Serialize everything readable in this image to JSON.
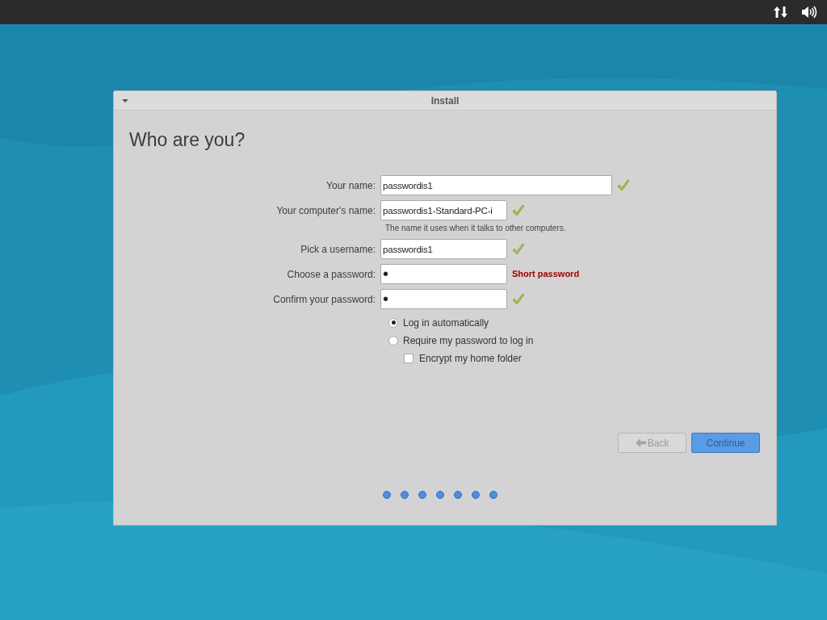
{
  "window": {
    "title": "Install"
  },
  "heading": "Who are you?",
  "fields": [
    {
      "label": "Your name:",
      "value": "passwordis1",
      "wide": true,
      "valid": true
    },
    {
      "label": "Your computer's name:",
      "value": "passwordis1-Standard-PC-i",
      "wide": false,
      "valid": true,
      "hint": "The name it uses when it talks to other computers."
    },
    {
      "label": "Pick a username:",
      "value": "passwordis1",
      "wide": false,
      "valid": true
    },
    {
      "label": "Choose a password:",
      "value": "•",
      "kind": "password",
      "wide": false,
      "valid": false,
      "message": "Short password"
    },
    {
      "label": "Confirm your password:",
      "value": "•",
      "kind": "password",
      "wide": false,
      "valid": true
    }
  ],
  "login_options": [
    {
      "label": "Log in automatically",
      "selected": true
    },
    {
      "label": "Require my password to log in",
      "selected": false,
      "children": [
        {
          "label": "Encrypt my home folder",
          "checked": false
        }
      ]
    }
  ],
  "buttons": [
    {
      "label": "Back",
      "disabled": true
    },
    {
      "label": "Continue",
      "disabled": false
    }
  ]
}
